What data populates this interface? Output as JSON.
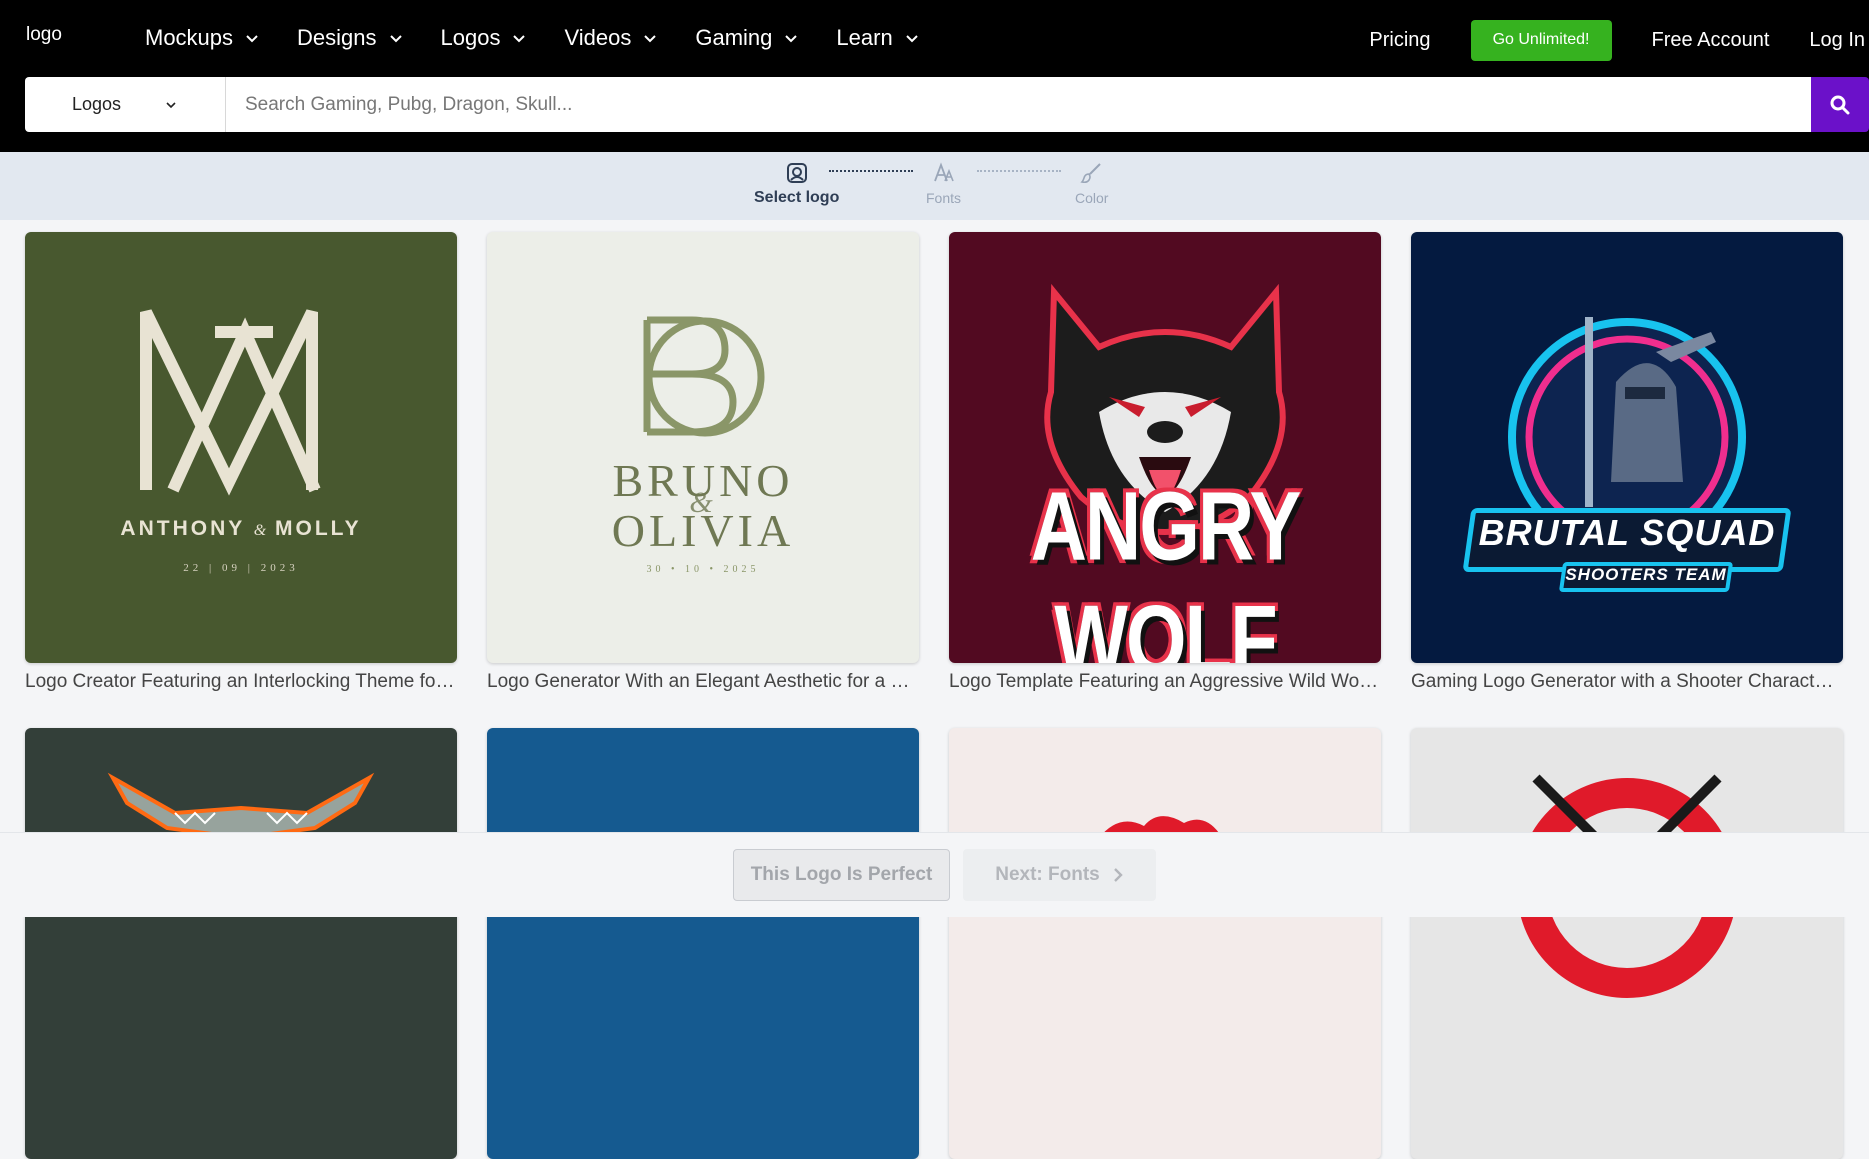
{
  "header": {
    "logo_text": "logo",
    "nav": [
      {
        "label": "Mockups"
      },
      {
        "label": "Designs"
      },
      {
        "label": "Logos"
      },
      {
        "label": "Videos"
      },
      {
        "label": "Gaming"
      },
      {
        "label": "Learn"
      }
    ],
    "pricing_label": "Pricing",
    "unlimited_label": "Go Unlimited!",
    "free_account_label": "Free Account",
    "login_label": "Log In",
    "accent_color": "#36b21f"
  },
  "search": {
    "category_value": "Logos",
    "placeholder": "Search Gaming, Pubg, Dragon, Skull...",
    "button_color": "#6b11c9",
    "icon": "search-icon"
  },
  "steps": [
    {
      "label": "Select logo",
      "icon": "logo-select-icon",
      "state": "active"
    },
    {
      "label": "Fonts",
      "icon": "font-icon",
      "state": "inactive"
    },
    {
      "label": "Color",
      "icon": "brush-icon",
      "state": "inactive"
    }
  ],
  "cards": [
    {
      "title": "Logo Creator Featuring an Interlocking Theme for a Wedding Monogram",
      "bg": "#48582f",
      "names_left": "ANTHONY",
      "names_amp": "&",
      "names_right": "MOLLY",
      "date": "22 | 09 | 2023"
    },
    {
      "title": "Logo Generator With an Elegant Aesthetic for a Wedding Monogram",
      "bg": "#eceee8",
      "name1": "BRUNO",
      "amp": "&",
      "name2": "OLIVIA",
      "date": "30 • 10 • 2025"
    },
    {
      "title": "Logo Template Featuring an Aggressive Wild Wolf Gaming Mascot",
      "bg": "#520a21",
      "text": "ANGRY WOLF"
    },
    {
      "title": "Gaming Logo Generator with a Shooter Character Illustration",
      "bg": "#041a40",
      "text1": "BRUTAL SQUAD",
      "text2": "SHOOTERS TEAM"
    },
    {
      "title": "",
      "bg": "#333f39"
    },
    {
      "title": "",
      "bg": "#155a90"
    },
    {
      "title": "",
      "bg": "#f3ebea"
    },
    {
      "title": "",
      "bg": "#e6e6e6"
    }
  ],
  "bottom": {
    "perfect_label": "This Logo Is Perfect",
    "next_label": "Next: Fonts"
  }
}
